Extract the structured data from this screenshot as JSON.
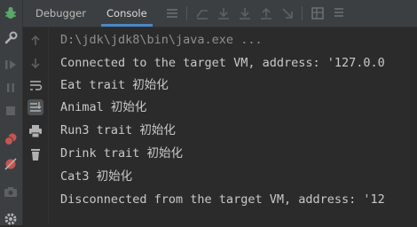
{
  "tabs": [
    {
      "label": "Debugger",
      "active": false
    },
    {
      "label": "Console",
      "active": true
    }
  ],
  "console": {
    "command_line": "D:\\jdk\\jdk8\\bin\\java.exe ...",
    "lines": [
      "Connected to the target VM, address: '127.0.0",
      "Eat trait 初始化",
      "Animal 初始化",
      "Run3 trait 初始化",
      "Drink trait 初始化",
      "Cat3 初始化",
      "Disconnected from the target VM, address: '12"
    ]
  },
  "colors": {
    "background": "#2b2b2b",
    "toolbar": "#3c3f41",
    "text": "#c9c9c9",
    "command_text": "#8f8f8f",
    "accent": "#4a88c7",
    "debug_green": "#59a869",
    "stop_red": "#c75450"
  },
  "icons": {
    "left_bar": [
      "debug-bug-icon",
      "settings-wrench-icon",
      "resume-icon",
      "pause-icon",
      "stop-icon",
      "view-breakpoints-icon",
      "mute-breakpoints-icon",
      "camera-icon",
      "gear-icon"
    ],
    "tab_toolbar": [
      "menu-icon",
      "show-execution-point-icon",
      "step-over-icon",
      "step-into-icon",
      "step-out-icon",
      "run-to-cursor-icon",
      "evaluate-expression-icon",
      "trace-icon"
    ],
    "console_toolbar": [
      "up-arrow-icon",
      "down-arrow-icon",
      "soft-wrap-icon",
      "scroll-to-end-icon",
      "print-icon",
      "clear-all-icon"
    ]
  }
}
